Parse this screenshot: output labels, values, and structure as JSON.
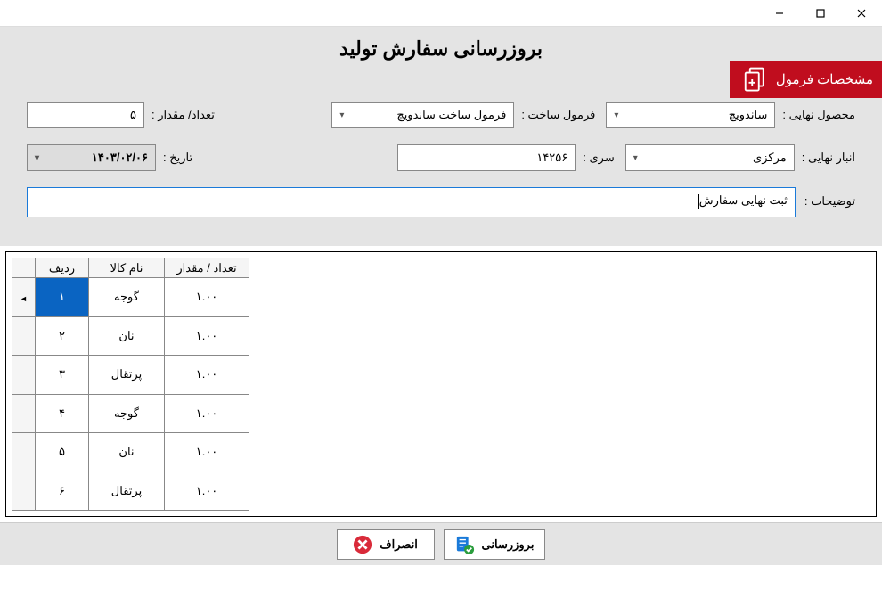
{
  "window": {
    "title": ""
  },
  "page_title": "بروزرسانی سفارش تولید",
  "badge": "مشخصات فرمول",
  "form": {
    "final_product_label": "محصول نهایی :",
    "final_product_value": "ساندویچ",
    "formula_label": "فرمول ساخت :",
    "formula_value": "فرمول ساخت ساندویچ",
    "qty_label": "تعداد/ مقدار :",
    "qty_value": "۵",
    "warehouse_label": "انبار نهایی :",
    "warehouse_value": "مرکزی",
    "serial_label": "سری :",
    "serial_value": "۱۴۲۵۶",
    "date_label": "تاریخ :",
    "date_value": "۱۴۰۳/۰۲/۰۶",
    "desc_label": "توضیحات :",
    "desc_value": "ثبت نهایی سفارش"
  },
  "grid": {
    "headers": {
      "row": "ردیف",
      "name": "نام کالا",
      "qty": "تعداد / مقدار"
    },
    "rows": [
      {
        "n": "۱",
        "name": "گوجه",
        "qty": "۱.۰۰"
      },
      {
        "n": "۲",
        "name": "نان",
        "qty": "۱.۰۰"
      },
      {
        "n": "۳",
        "name": "پرتقال",
        "qty": "۱.۰۰"
      },
      {
        "n": "۴",
        "name": "گوجه",
        "qty": "۱.۰۰"
      },
      {
        "n": "۵",
        "name": "نان",
        "qty": "۱.۰۰"
      },
      {
        "n": "۶",
        "name": "پرتقال",
        "qty": "۱.۰۰"
      }
    ]
  },
  "buttons": {
    "update": "بروزرسانی",
    "cancel": "انصراف"
  }
}
